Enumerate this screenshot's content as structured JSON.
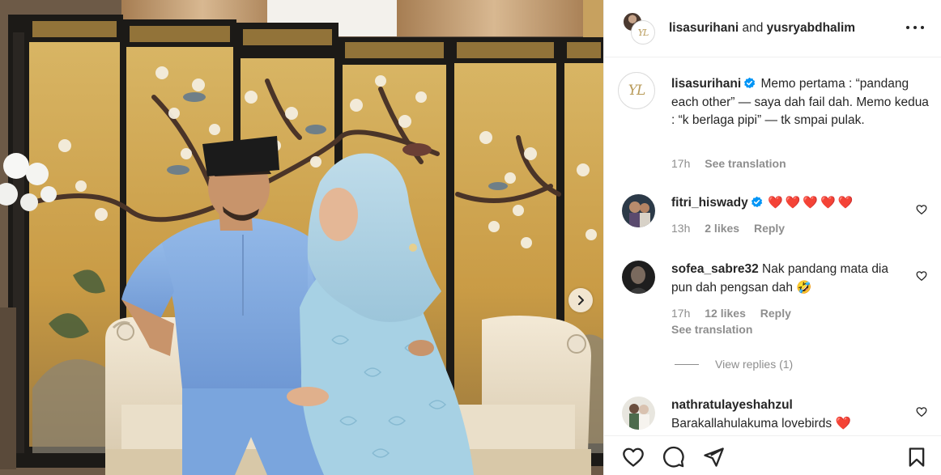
{
  "post": {
    "photo_alt": "couple-engagement-photo"
  },
  "header": {
    "user1": "lisasurihani",
    "joiner": "and",
    "user2": "yusryabdhalim",
    "avatar_monogram": "YL",
    "more_icon": "more-horizontal-icon"
  },
  "caption": {
    "username": "lisasurihani",
    "verified": true,
    "text": "Memo pertama : “pandang each other” — saya dah fail dah. Memo kedua : “k berlaga pipi” — tk smpai pulak.",
    "time": "17h",
    "translate": "See translation"
  },
  "comments": [
    {
      "username": "fitri_hiswady",
      "verified": true,
      "text": "❤️❤️❤️❤️❤️",
      "time": "13h",
      "likes": "2 likes",
      "reply": "Reply"
    },
    {
      "username": "sofea_sabre32",
      "verified": false,
      "text": "Nak pandang mata dia pun dah pengsan dah 🤣",
      "time": "17h",
      "likes": "12 likes",
      "reply": "Reply",
      "translate": "See translation",
      "view_replies": "View replies (1)"
    },
    {
      "username": "nathratulayeshahzul",
      "verified": false,
      "text": "Barakallahulakuma lovebirds ❤️"
    }
  ],
  "actions": {
    "like": "heart-icon",
    "comment": "comment-icon",
    "share": "paper-plane-icon",
    "save": "bookmark-icon"
  },
  "colors": {
    "verified": "#0095f6",
    "heart": "#ed1b3b",
    "muted": "#8e8e8e",
    "text": "#262626"
  }
}
